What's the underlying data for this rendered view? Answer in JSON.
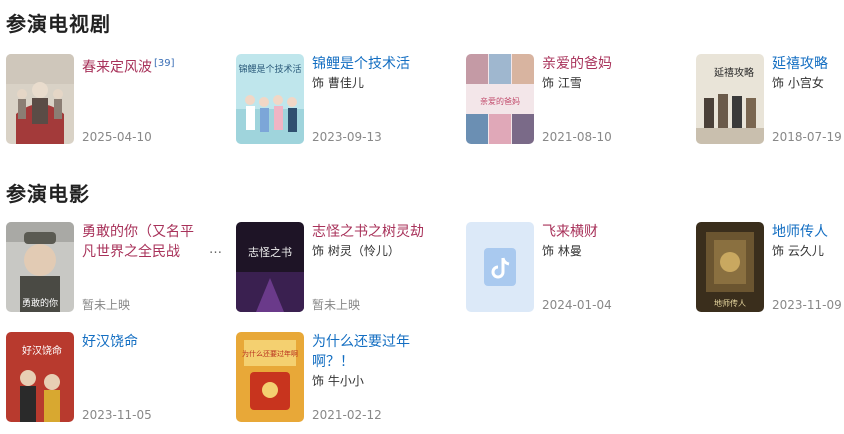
{
  "tv": {
    "heading": "参演电视剧",
    "items": [
      {
        "title": "春来定风波",
        "ref": "[39]",
        "role": "",
        "date": "2025-04-10"
      },
      {
        "title": "锦鲤是个技术活",
        "role": "饰 曹佳儿",
        "date": "2023-09-13"
      },
      {
        "title": "亲爱的爸妈",
        "role": "饰 江雪",
        "date": "2021-08-10"
      },
      {
        "title": "延禧攻略",
        "role": "饰 小宫女",
        "date": "2018-07-19"
      }
    ]
  },
  "movies": {
    "heading": "参演电影",
    "items": [
      {
        "title_line1": "勇敢的你（又名平",
        "title_line2": "凡世界之全民战",
        "ellipsis": "…",
        "role": "",
        "date": "暂未上映"
      },
      {
        "title": "志怪之书之树灵劫",
        "role": "饰 树灵（怜儿）",
        "date": "暂未上映"
      },
      {
        "title": "飞来横财",
        "role": "饰 林曼",
        "date": "2024-01-04"
      },
      {
        "title": "地师传人",
        "role": "饰 云久儿",
        "date": "2023-11-09"
      },
      {
        "title": "好汉饶命",
        "role": "",
        "date": "2023-11-05"
      },
      {
        "title_line1": "为什么还要过年",
        "title_line2": "啊？！",
        "role": "饰 牛小小",
        "date": "2021-02-12"
      }
    ]
  },
  "poster_text": {
    "jinli": "锦鲤是个技术活",
    "qinai": "亲爱的爸妈",
    "yanxi": "延禧攻略",
    "yonggan": "勇敢的你",
    "zhiguai": "志怪之书",
    "dishi": "地师传人",
    "haohan": "好汉饶命",
    "weishenme": "为什么还要过年啊"
  }
}
